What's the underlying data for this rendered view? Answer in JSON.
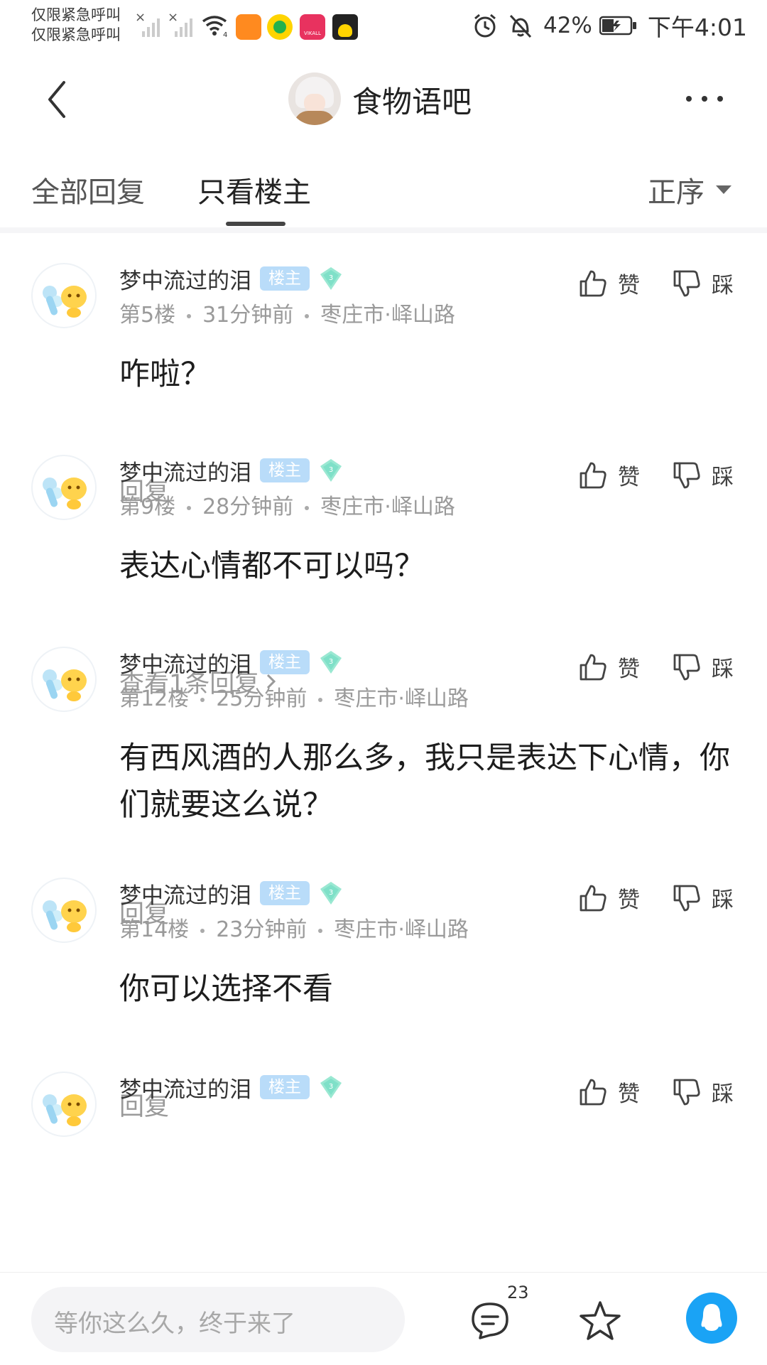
{
  "status_bar": {
    "carrier_line1": "仅限紧急呼叫",
    "carrier_line2": "仅限紧急呼叫",
    "battery": "42%",
    "time": "下午4:01",
    "app_badge_text": "VIKALL"
  },
  "header": {
    "title": "食物语吧"
  },
  "tabs": {
    "all_replies": "全部回复",
    "only_op": "只看楼主",
    "sort": "正序"
  },
  "posts": [
    {
      "username": "梦中流过的泪",
      "badge": "楼主",
      "level": "3",
      "floor": "第5楼",
      "time": "31分钟前",
      "location": "枣庄市·峄山路",
      "content": "咋啦？",
      "reply": "回复",
      "like": "赞",
      "dislike": "踩"
    },
    {
      "username": "梦中流过的泪",
      "badge": "楼主",
      "level": "3",
      "floor": "第9楼",
      "time": "28分钟前",
      "location": "枣庄市·峄山路",
      "content": "表达心情都不可以吗？",
      "reply": "查看1条回复",
      "like": "赞",
      "dislike": "踩"
    },
    {
      "username": "梦中流过的泪",
      "badge": "楼主",
      "level": "3",
      "floor": "第12楼",
      "time": "25分钟前",
      "location": "枣庄市·峄山路",
      "content": "有西风酒的人那么多，我只是表达下心情，你们就要这么说？",
      "reply": "回复",
      "like": "赞",
      "dislike": "踩"
    },
    {
      "username": "梦中流过的泪",
      "badge": "楼主",
      "level": "3",
      "floor": "第14楼",
      "time": "23分钟前",
      "location": "枣庄市·峄山路",
      "content": "你可以选择不看",
      "reply": "回复",
      "like": "赞",
      "dislike": "踩"
    },
    {
      "username": "梦中流过的泪",
      "badge": "楼主",
      "level": "3",
      "like": "赞",
      "dislike": "踩"
    }
  ],
  "bottom_bar": {
    "input_placeholder": "等你这么久，终于来了",
    "comment_count": "23"
  },
  "colors": {
    "accent_blue": "#1aa3f5",
    "op_badge": "#b9dcf9",
    "level_badge": "#7fe0c8"
  }
}
